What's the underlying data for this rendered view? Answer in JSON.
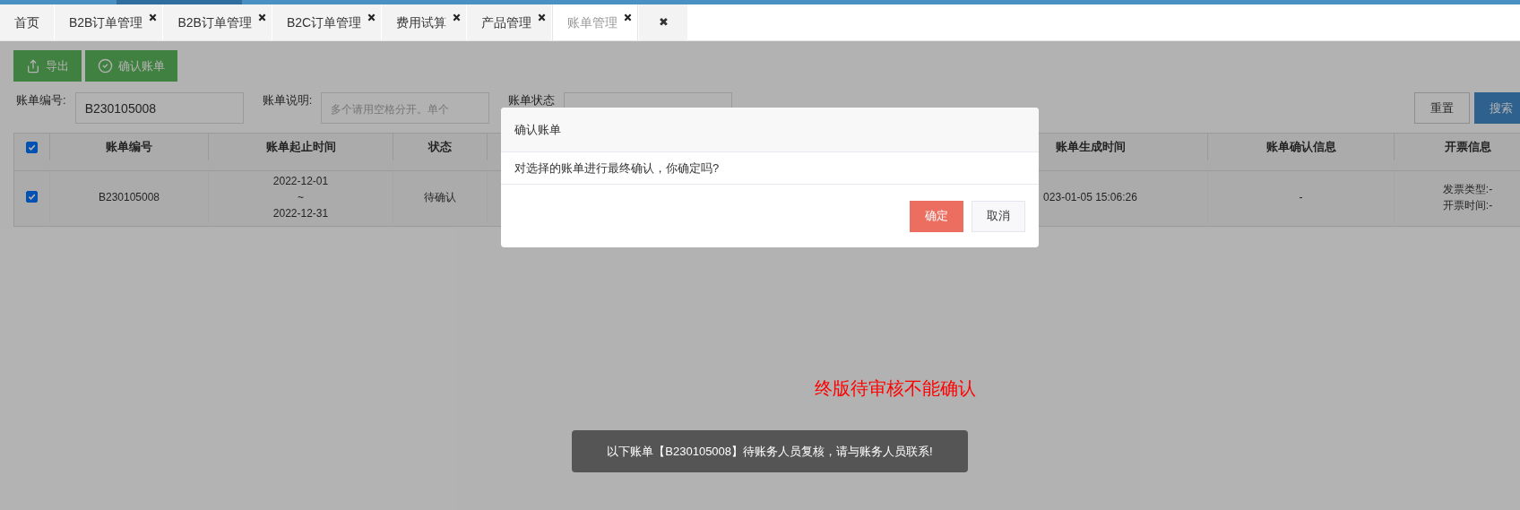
{
  "tabs": [
    {
      "label": "首页",
      "closable": false,
      "selected": false
    },
    {
      "label": "B2B订单管理",
      "closable": true,
      "selected": false
    },
    {
      "label": "B2B订单管理",
      "closable": true,
      "selected": false
    },
    {
      "label": "B2C订单管理",
      "closable": true,
      "selected": false
    },
    {
      "label": "费用试算",
      "closable": true,
      "selected": false
    },
    {
      "label": "产品管理",
      "closable": true,
      "selected": false
    },
    {
      "label": "账单管理",
      "closable": true,
      "selected": true
    }
  ],
  "close_all": "✖",
  "toolbar": [
    {
      "label": "导出",
      "kind": "export"
    },
    {
      "label": "确认账单",
      "kind": "confirm"
    }
  ],
  "filters": [
    {
      "label": "账单编号:",
      "value": "B230105008"
    },
    {
      "label": "账单说明:",
      "placeholder": "多个请用空格分开。单个"
    },
    {
      "label": "账单状态"
    }
  ],
  "filter_buttons": [
    {
      "label": "重置",
      "kind": "reset"
    },
    {
      "label": "搜索",
      "kind": "search"
    }
  ],
  "table": {
    "all_checked": true,
    "columns": [
      "账单编号",
      "账单起止时间",
      "状态",
      "",
      "账单生成时间",
      "账单确认信息",
      "开票信息"
    ],
    "rows": [
      {
        "checked": true,
        "cells": [
          "B230105008",
          [
            "2022-12-01",
            "~",
            "2022-12-31"
          ],
          "待确认",
          "",
          "023-01-05 15:06:26",
          "-",
          [
            "发票类型:-",
            "开票时间:-"
          ]
        ]
      }
    ]
  },
  "dialog": {
    "title": "确认账单",
    "message": "对选择的账单进行最终确认，你确定吗?",
    "buttons": [
      {
        "label": "确定",
        "kind": "primary"
      },
      {
        "label": "取消",
        "kind": "default"
      }
    ]
  },
  "annotation": "终版待审核不能确认",
  "toast": "以下账单【B230105008】待账务人员复核，请与账务人员联系!"
}
